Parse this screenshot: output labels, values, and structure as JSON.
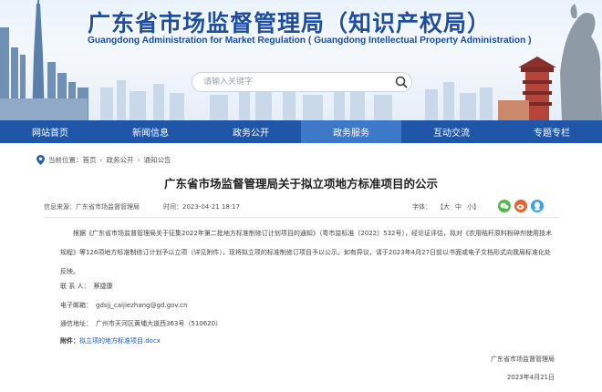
{
  "header": {
    "title": "广东省市场监督管理局（知识产权局）",
    "subtitle": "Guangdong Administration for Market Regulation ( Guangdong Intellectual Property Administration )",
    "search_placeholder": "请输入关键字"
  },
  "nav": {
    "items": [
      {
        "label": "网站首页"
      },
      {
        "label": "新闻信息"
      },
      {
        "label": "政务公开"
      },
      {
        "label": "政务服务",
        "active": true
      },
      {
        "label": "互动交流"
      },
      {
        "label": "专题专栏"
      }
    ]
  },
  "breadcrumb": {
    "prefix": "当前位置：",
    "items": [
      "首页",
      "政务公开",
      "通知公告"
    ],
    "separator": "›"
  },
  "article": {
    "title": "广东省市场监督管理局关于拟立项地方标准项目的公示",
    "source_label": "信息来源：",
    "source": "广东省市场监督管理局",
    "date_label": "时间：",
    "date": "2023-04-21 18:17",
    "font_size_label": "字体：",
    "font_sizes": [
      "【大",
      "中",
      "小】"
    ],
    "body": "根据《广东省市场监督管理局关于征集2022年第二批地方标准制修订计划项目的通知》（粤市监标准〔2022〕532号），经论证评估，拟对《农用秸秆原料粉碎剂使用技术规程》等126项地方标准制修订计划予以立项（详见附件），现将拟立项的标准制修订项目予以公示。如有异议，请于2023年4月27日前以书面或电子文档形式向我局标准化处反映。",
    "contact_label": "联 系 人：",
    "contact": "蔡捷康",
    "email_label": "电子邮箱：",
    "email": "gdsjj_caijiezhang@gd.gov.cn",
    "address_label": "通信地址：",
    "address": "广州市天河区黄埔大道西363号（510620）",
    "attachment_label": "附件：",
    "attachment": "拟立项的地方标准项目.docx",
    "signature": "广东省市场监督管理局",
    "sign_date": "2023年4月21日"
  },
  "colors": {
    "brand_blue": "#1f56a8",
    "nav_active": "#3d78c9",
    "wechat_green": "#50b848",
    "weibo_orange": "#e8612c",
    "qq_blue": "#3aa0e8",
    "location_blue": "#2a5fb0"
  },
  "icons": [
    "search-icon",
    "location-icon",
    "wechat-icon",
    "weibo-icon",
    "qq-icon"
  ]
}
